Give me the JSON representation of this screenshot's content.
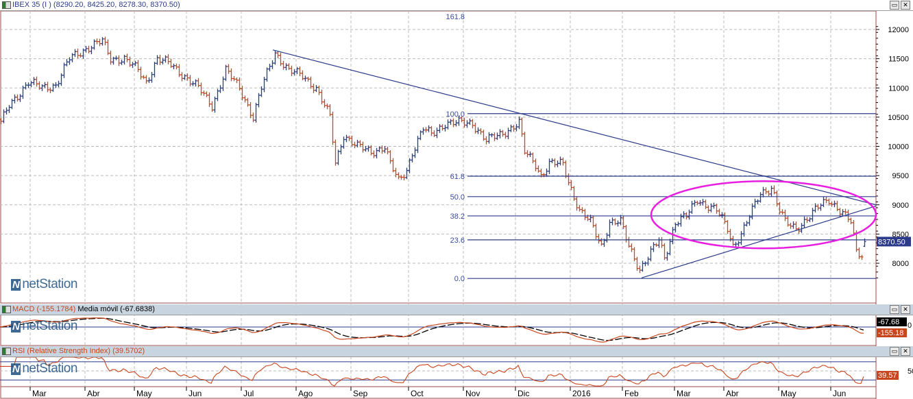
{
  "header": {
    "symbol": "IBEX 35 (I )",
    "ohlc_text": "(8290.20, 8425.20, 8278.30, 8370.50)"
  },
  "watermark": "netStation",
  "window_buttons": {
    "restore": "▭",
    "close": "✕"
  },
  "colors": {
    "up": "#2b3a8a",
    "down": "#c8461e",
    "line": "#2b3a8a",
    "ellipse": "#e81ee0",
    "macd": "#c8461e",
    "signal": "#000000",
    "rsi": "#c8461e",
    "border": "#9c4a4a"
  },
  "chart_data": {
    "type": "ohlc",
    "title": "IBEX 35 (I )",
    "y_ticks": [
      8000,
      8500,
      9000,
      9500,
      10000,
      10500,
      11000,
      11500,
      12000
    ],
    "ylim": [
      7550,
      12100
    ],
    "last_price_label": "8370.50",
    "last_bar": {
      "open": 8290.2,
      "high": 8425.2,
      "low": 8278.3,
      "close": 8370.5
    },
    "x_months": [
      {
        "label": "Mar",
        "day": 11
      },
      {
        "label": "Abr",
        "day": 31
      },
      {
        "label": "May",
        "day": 49
      },
      {
        "label": "Jun",
        "day": 68
      },
      {
        "label": "Jul",
        "day": 88
      },
      {
        "label": "Ago",
        "day": 108
      },
      {
        "label": "Sep",
        "day": 128
      },
      {
        "label": "Oct",
        "day": 149
      },
      {
        "label": "Nov",
        "day": 169
      },
      {
        "label": "Dic",
        "day": 188
      },
      {
        "label": "2016",
        "day": 208
      },
      {
        "label": "Feb",
        "day": 227
      },
      {
        "label": "Mar",
        "day": 246
      },
      {
        "label": "Abr",
        "day": 264
      },
      {
        "label": "May",
        "day": 284
      },
      {
        "label": "Jun",
        "day": 303
      }
    ],
    "close_anchors": [
      [
        0,
        10400
      ],
      [
        3,
        10700
      ],
      [
        10,
        11100
      ],
      [
        15,
        11000
      ],
      [
        20,
        11050
      ],
      [
        25,
        11500
      ],
      [
        32,
        11700
      ],
      [
        37,
        11800
      ],
      [
        40,
        11500
      ],
      [
        45,
        11500
      ],
      [
        50,
        11300
      ],
      [
        53,
        11100
      ],
      [
        57,
        11500
      ],
      [
        62,
        11400
      ],
      [
        67,
        11200
      ],
      [
        72,
        11000
      ],
      [
        77,
        10700
      ],
      [
        82,
        11300
      ],
      [
        87,
        11000
      ],
      [
        92,
        10500
      ],
      [
        95,
        11000
      ],
      [
        100,
        11600
      ],
      [
        105,
        11300
      ],
      [
        110,
        11200
      ],
      [
        115,
        11000
      ],
      [
        120,
        10500
      ],
      [
        122,
        9700
      ],
      [
        125,
        10200
      ],
      [
        130,
        10000
      ],
      [
        135,
        9900
      ],
      [
        140,
        10000
      ],
      [
        142,
        9700
      ],
      [
        145,
        9400
      ],
      [
        148,
        9600
      ],
      [
        150,
        9900
      ],
      [
        154,
        10300
      ],
      [
        157,
        10200
      ],
      [
        162,
        10400
      ],
      [
        167,
        10400
      ],
      [
        172,
        10400
      ],
      [
        177,
        10100
      ],
      [
        182,
        10200
      ],
      [
        189,
        10400
      ],
      [
        191,
        9900
      ],
      [
        195,
        9700
      ],
      [
        197,
        9500
      ],
      [
        200,
        9700
      ],
      [
        205,
        9700
      ],
      [
        207,
        9400
      ],
      [
        211,
        8900
      ],
      [
        215,
        8700
      ],
      [
        219,
        8300
      ],
      [
        222,
        8700
      ],
      [
        226,
        8700
      ],
      [
        229,
        8300
      ],
      [
        233,
        7900
      ],
      [
        236,
        8100
      ],
      [
        240,
        8400
      ],
      [
        242,
        8100
      ],
      [
        246,
        8700
      ],
      [
        250,
        8800
      ],
      [
        254,
        9100
      ],
      [
        257,
        9000
      ],
      [
        261,
        8900
      ],
      [
        265,
        8600
      ],
      [
        267,
        8300
      ],
      [
        270,
        8500
      ],
      [
        274,
        8900
      ],
      [
        277,
        9200
      ],
      [
        281,
        9300
      ],
      [
        284,
        8900
      ],
      [
        286,
        8700
      ],
      [
        290,
        8600
      ],
      [
        295,
        8800
      ],
      [
        299,
        9000
      ],
      [
        302,
        9100
      ],
      [
        306,
        8900
      ],
      [
        310,
        8700
      ],
      [
        312,
        8200
      ],
      [
        314,
        8150
      ],
      [
        315,
        8370
      ]
    ],
    "fibonacci": {
      "start_day": 170,
      "levels": [
        {
          "label": "161.8",
          "price": 12320
        },
        {
          "label": "100.0",
          "price": 10560
        },
        {
          "label": "61.8",
          "price": 9490
        },
        {
          "label": "50.0",
          "price": 9140
        },
        {
          "label": "38.2",
          "price": 8810
        },
        {
          "label": "23.6",
          "price": 8400
        },
        {
          "label": "0.0",
          "price": 7740
        }
      ]
    },
    "trendlines": [
      {
        "name": "resistance",
        "from": [
          99.5,
          11650
        ],
        "to": [
          319.5,
          9000
        ]
      },
      {
        "name": "support",
        "from": [
          234,
          7750
        ],
        "to": [
          319.5,
          8980
        ]
      }
    ],
    "ellipse": {
      "center_day": 278.5,
      "center_price": 8830,
      "radius_days": 41,
      "radius_price": 575
    },
    "macd": {
      "title": "MACD (-155.1784)",
      "signal_title": "Media móvil (-67.6838)",
      "macd_label": "-155.18",
      "signal_label": "-67.68",
      "zero_label": "0",
      "macd_value": -155.1784,
      "signal_value": -67.6838
    },
    "rsi": {
      "title": "RSI (Relative Strength Index) (39.5702)",
      "value_label": "39.57",
      "tick_label": "50",
      "value": 39.5702,
      "upper": 70,
      "lower": 30
    }
  }
}
